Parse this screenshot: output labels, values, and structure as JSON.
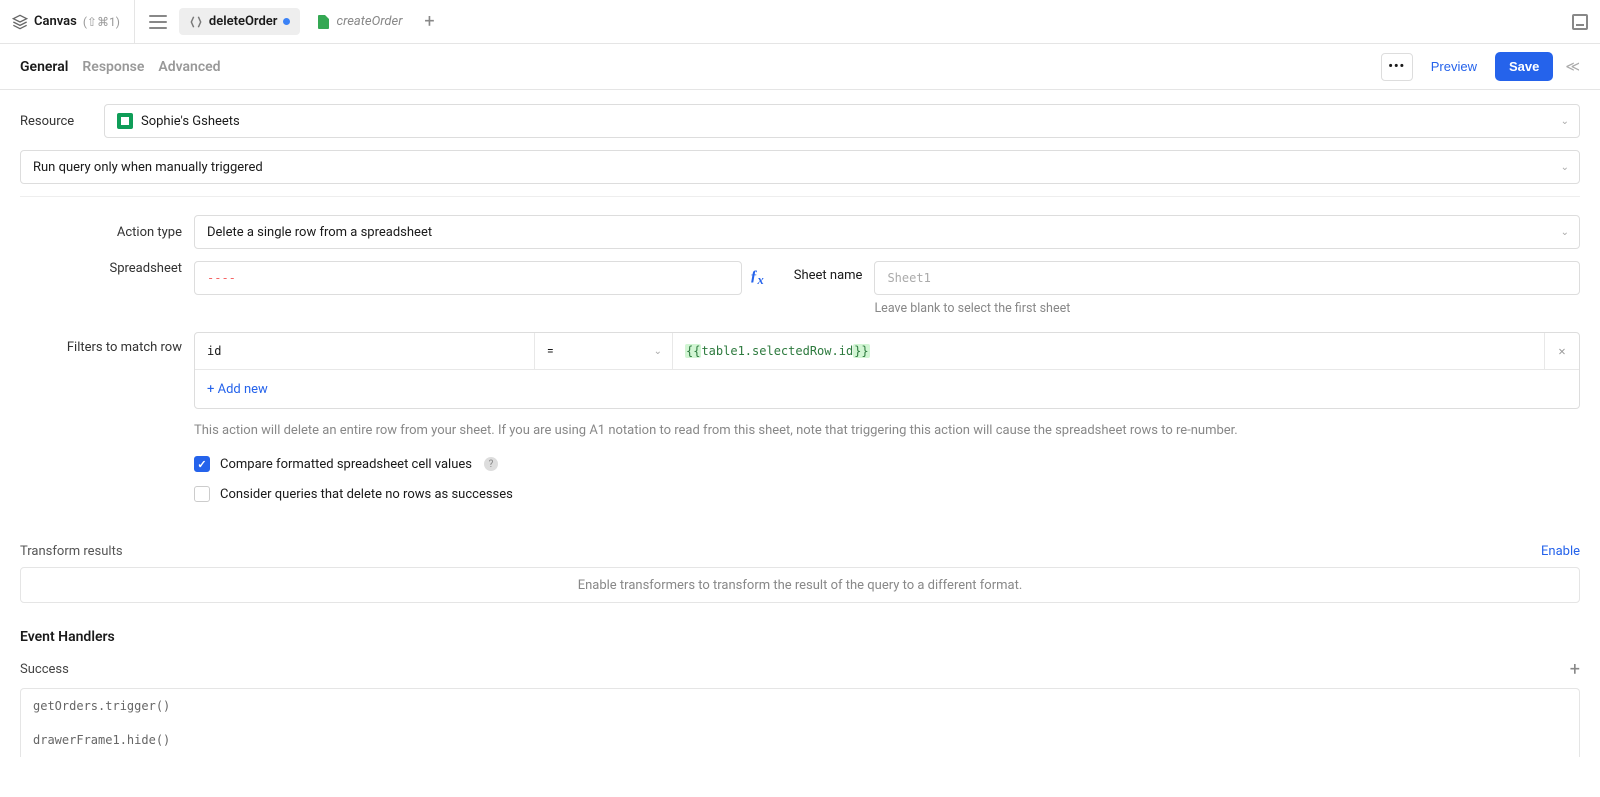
{
  "topbar": {
    "canvas_label": "Canvas",
    "canvas_shortcut": "(⇧⌘1)",
    "tabs": [
      {
        "label": "deleteOrder",
        "active": true,
        "dirty": true
      },
      {
        "label": "createOrder",
        "active": false,
        "dirty": false
      }
    ]
  },
  "subheader": {
    "tabs": {
      "general": "General",
      "response": "Response",
      "advanced": "Advanced"
    },
    "preview": "Preview",
    "save": "Save",
    "more": "•••"
  },
  "resource": {
    "label": "Resource",
    "value": "Sophie's Gsheets"
  },
  "run_mode": "Run query only when manually triggered",
  "action_type": {
    "label": "Action type",
    "value": "Delete a single row from a spreadsheet"
  },
  "spreadsheet": {
    "label": "Spreadsheet",
    "value": "----",
    "fx": "fx"
  },
  "sheet_name": {
    "label": "Sheet name",
    "placeholder": "Sheet1",
    "hint": "Leave blank to select the first sheet"
  },
  "filters": {
    "label": "Filters to match row",
    "row": {
      "key": "id",
      "op": "=",
      "val_open": "{{",
      "val_ref": "table1.selectedRow.id",
      "val_close": "}}"
    },
    "add_new": "+ Add new",
    "note": "This action will delete an entire row from your sheet. If you are using A1 notation to read from this sheet, note that triggering this action will cause the spreadsheet rows to re-number."
  },
  "checks": {
    "compare": "Compare formatted spreadsheet cell values",
    "consider": "Consider queries that delete no rows as successes"
  },
  "transform": {
    "title": "Transform results",
    "enable": "Enable",
    "placeholder": "Enable transformers to transform the result of the query to a different format."
  },
  "event_handlers": {
    "title": "Event Handlers",
    "success": "Success",
    "handlers": [
      "getOrders.trigger()",
      "drawerFrame1.hide()"
    ]
  }
}
